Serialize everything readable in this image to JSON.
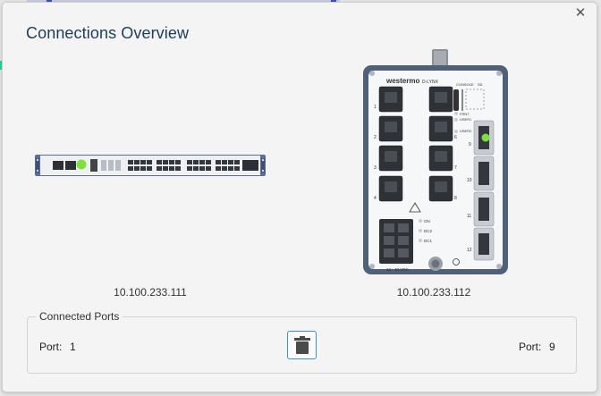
{
  "dialog": {
    "title": "Connections Overview",
    "close_icon": "close-icon"
  },
  "devices": [
    {
      "ip": "10.100.233.111",
      "kind": "rack-switch",
      "active_port": 1
    },
    {
      "ip": "10.100.233.112",
      "kind": "din-rail-switch",
      "active_port": 9,
      "brand_text": "westermo",
      "model_text": "D-LYNX",
      "labels": {
        "console": "CONSOLE",
        "sd": "SD",
        "frnt": "FRNT",
        "user1": "USER1",
        "user2": "USER2",
        "on": "ON",
        "dc2": "DC2",
        "dc1": "DC1",
        "voltage": "12 - 48 VDC"
      }
    }
  ],
  "connected_ports": {
    "legend": "Connected Ports",
    "left_label": "Port:",
    "left_value": "1",
    "right_label": "Port:",
    "right_value": "9",
    "delete_icon": "trash-icon"
  },
  "colors": {
    "accent": "#3c8fd0",
    "title": "#1f3b5a",
    "link_led": "#7ee03a"
  }
}
